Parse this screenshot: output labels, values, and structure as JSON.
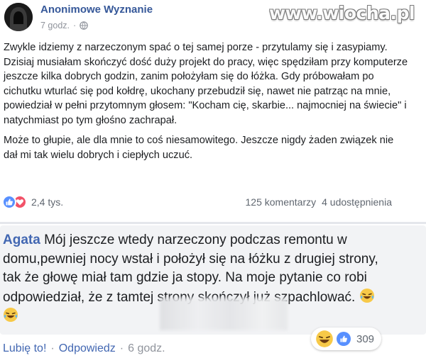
{
  "post": {
    "author": "Anonimowe Wyznanie",
    "time": "7 godz.",
    "audience_icon": "globe-icon",
    "paragraphs": [
      "Zwykle idziemy z narzeczonym spać o tej samej porze - przytulamy się i zasypiamy. Dzisiaj musiałam skończyć dość duży projekt do pracy, więc spędziłam przy komputerze jeszcze kilka dobrych godzin, zanim położyłam się do łóżka. Gdy próbowałam po cichutku wturlać się pod kołdrę, ukochany przebudził się, nawet nie patrząc na mnie, powiedział w pełni przytomnym głosem: \"Kocham cię, skarbie... najmocniej na świecie\" i natychmiast po tym głośno zachrapał.",
      "Może to głupie, ale dla mnie to coś niesamowitego. Jeszcze nigdy żaden związek nie dał mi tak wielu dobrych i ciepłych uczuć."
    ],
    "reactions_count": "2,4 tys.",
    "comments_count": "125 komentarzy",
    "shares_count": "4 udostępnienia"
  },
  "watermark": "www.wiocha.pl",
  "comment": {
    "author": "Agata",
    "lines": [
      " Mój jeszcze wtedy narzeczony podczas remontu w",
      "domu,pewniej nocy wstał i położył się na łóżku z drugiej strony,",
      " tak że głowę miał tam gdzie ja stopy. Na moje pytanie co robi",
      "odpowiedział, że z tamtej strony skończył już szpachlować."
    ],
    "reaction_count": "309",
    "like_label": "Lubię to!",
    "separator": "·",
    "reply_label": "Odpowiedz",
    "time": "6 godz."
  },
  "colors": {
    "link_blue": "#365899",
    "comment_author": "#4267b2",
    "like_blue": "#5890ff",
    "love_red": "#f25268",
    "bubble_bg": "#f2f3f5"
  }
}
